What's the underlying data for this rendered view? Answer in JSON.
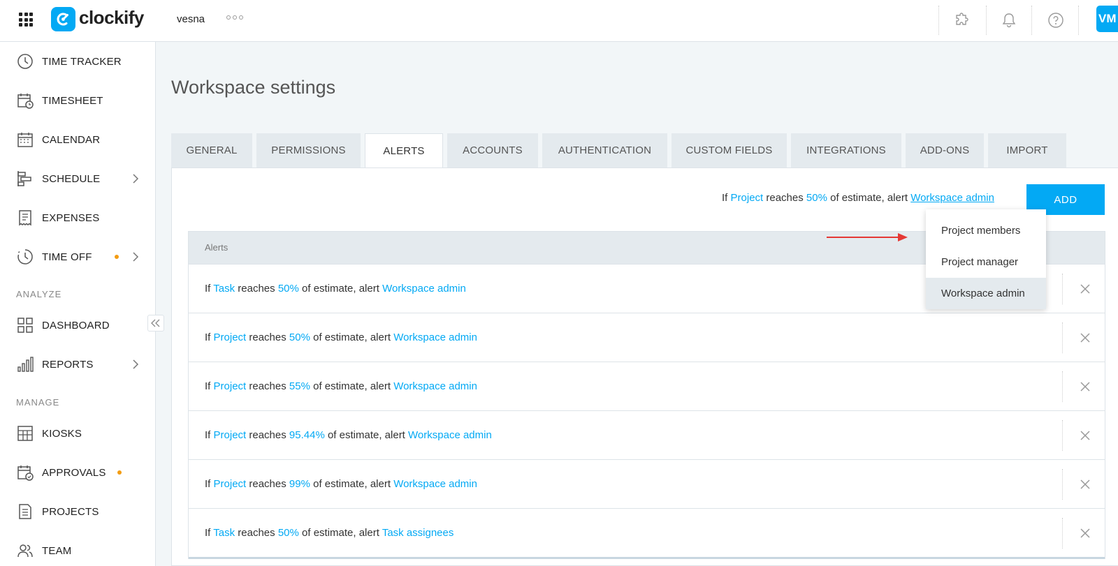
{
  "topbar": {
    "logo_text": "clockify",
    "workspace_name": "vesna",
    "avatar_initials": "VM"
  },
  "sidebar": {
    "items": [
      {
        "label": "TIME TRACKER",
        "icon": "clock-icon"
      },
      {
        "label": "TIMESHEET",
        "icon": "timesheet-icon"
      },
      {
        "label": "CALENDAR",
        "icon": "calendar-icon"
      },
      {
        "label": "SCHEDULE",
        "icon": "schedule-icon"
      },
      {
        "label": "EXPENSES",
        "icon": "receipt-icon"
      },
      {
        "label": "TIME OFF",
        "icon": "time-off-icon"
      },
      {
        "label": "DASHBOARD",
        "icon": "dashboard-icon"
      },
      {
        "label": "REPORTS",
        "icon": "reports-icon"
      },
      {
        "label": "KIOSKS",
        "icon": "kiosk-icon"
      },
      {
        "label": "APPROVALS",
        "icon": "approvals-icon"
      },
      {
        "label": "PROJECTS",
        "icon": "projects-icon"
      },
      {
        "label": "TEAM",
        "icon": "team-icon"
      }
    ],
    "sections": {
      "analyze": "ANALYZE",
      "manage": "MANAGE"
    }
  },
  "page": {
    "title": "Workspace settings",
    "tabs": [
      "GENERAL",
      "PERMISSIONS",
      "ALERTS",
      "ACCOUNTS",
      "AUTHENTICATION",
      "CUSTOM FIELDS",
      "INTEGRATIONS",
      "ADD-ONS",
      "IMPORT"
    ],
    "active_tab": "ALERTS"
  },
  "composer": {
    "if": "If",
    "entity": "Project",
    "reaches": "reaches",
    "percent": "50%",
    "of_estimate": "of estimate, alert",
    "recipient": "Workspace admin",
    "add_label": "ADD"
  },
  "dropdown": {
    "options": [
      "Project members",
      "Project manager",
      "Workspace admin"
    ],
    "selected": "Workspace admin"
  },
  "alerts_table": {
    "header": "Alerts",
    "rows": [
      {
        "if": "If",
        "entity": "Task",
        "reaches": "reaches",
        "percent": "50%",
        "of_estimate": "of estimate, alert",
        "recipient": "Workspace admin"
      },
      {
        "if": "If",
        "entity": "Project",
        "reaches": "reaches",
        "percent": "50%",
        "of_estimate": "of estimate, alert",
        "recipient": "Workspace admin"
      },
      {
        "if": "If",
        "entity": "Project",
        "reaches": "reaches",
        "percent": "55%",
        "of_estimate": "of estimate, alert",
        "recipient": "Workspace admin"
      },
      {
        "if": "If",
        "entity": "Project",
        "reaches": "reaches",
        "percent": "95.44%",
        "of_estimate": "of estimate, alert",
        "recipient": "Workspace admin"
      },
      {
        "if": "If",
        "entity": "Project",
        "reaches": "reaches",
        "percent": "99%",
        "of_estimate": "of estimate, alert",
        "recipient": "Workspace admin"
      },
      {
        "if": "If",
        "entity": "Task",
        "reaches": "reaches",
        "percent": "50%",
        "of_estimate": "of estimate, alert",
        "recipient": "Task assignees"
      }
    ]
  },
  "colors": {
    "accent": "#03a9f4",
    "dot": "#f39c12",
    "arrow": "#e53935"
  }
}
